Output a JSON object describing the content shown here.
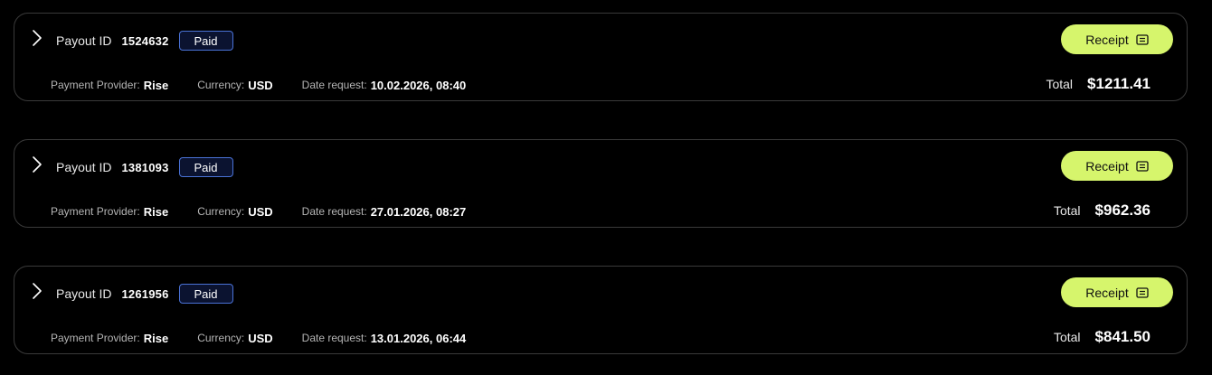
{
  "payout_id_label": "Payout ID",
  "receipt_label": "Receipt",
  "provider_label": "Payment Provider:",
  "currency_label": "Currency:",
  "date_label": "Date request:",
  "total_label": "Total",
  "colors": {
    "receipt_button": "#d6f56c",
    "paid_badge_border": "#4a72d6",
    "card_border": "#3a3a3a"
  },
  "payouts": [
    {
      "id": "1524632",
      "status": "Paid",
      "provider": "Rise",
      "currency": "USD",
      "date_request": "10.02.2026, 08:40",
      "total": "$1211.41"
    },
    {
      "id": "1381093",
      "status": "Paid",
      "provider": "Rise",
      "currency": "USD",
      "date_request": "27.01.2026, 08:27",
      "total": "$962.36"
    },
    {
      "id": "1261956",
      "status": "Paid",
      "provider": "Rise",
      "currency": "USD",
      "date_request": "13.01.2026, 06:44",
      "total": "$841.50"
    }
  ]
}
